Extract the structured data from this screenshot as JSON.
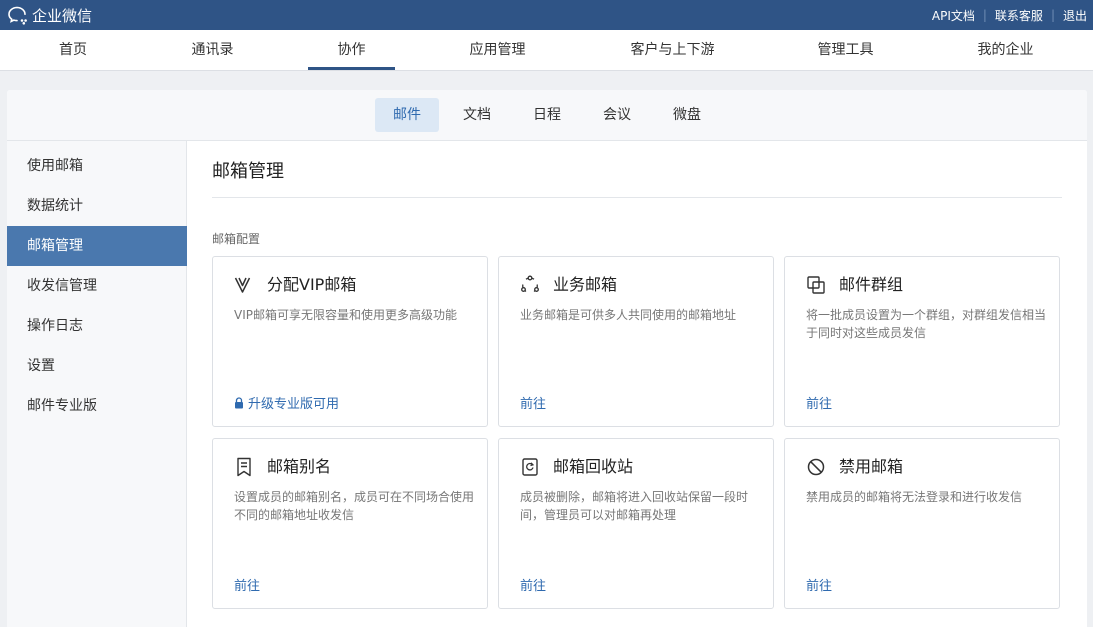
{
  "app": {
    "title": "企业微信"
  },
  "top_links": {
    "api_docs": "API文档",
    "support": "联系客服",
    "logout": "退出"
  },
  "main_nav": [
    "首页",
    "通讯录",
    "协作",
    "应用管理",
    "客户与上下游",
    "管理工具",
    "我的企业"
  ],
  "main_nav_active": "协作",
  "sub_tabs": [
    "邮件",
    "文档",
    "日程",
    "会议",
    "微盘"
  ],
  "sub_tab_active": "邮件",
  "sidebar": [
    "使用邮箱",
    "数据统计",
    "邮箱管理",
    "收发信管理",
    "操作日志",
    "设置",
    "邮件专业版"
  ],
  "sidebar_active": "邮箱管理",
  "page_title": "邮箱管理",
  "section_label": "邮箱配置",
  "cards": [
    {
      "icon": "vip-icon",
      "title": "分配VIP邮箱",
      "desc": "VIP邮箱可享无限容量和使用更多高级功能",
      "link": "升级专业版可用",
      "locked": true
    },
    {
      "icon": "business-mailbox-icon",
      "title": "业务邮箱",
      "desc": "业务邮箱是可供多人共同使用的邮箱地址",
      "link": "前往",
      "locked": false
    },
    {
      "icon": "mail-group-icon",
      "title": "邮件群组",
      "desc": "将一批成员设置为一个群组，对群组发信相当于同时对这些成员发信",
      "link": "前往",
      "locked": false
    },
    {
      "icon": "alias-icon",
      "title": "邮箱别名",
      "desc": "设置成员的邮箱别名，成员可在不同场合使用不同的邮箱地址收发信",
      "link": "前往",
      "locked": false
    },
    {
      "icon": "recycle-bin-icon",
      "title": "邮箱回收站",
      "desc": "成员被删除，邮箱将进入回收站保留一段时间，管理员可以对邮箱再处理",
      "link": "前往",
      "locked": false
    },
    {
      "icon": "ban-icon",
      "title": "禁用邮箱",
      "desc": "禁用成员的邮箱将无法登录和进行收发信",
      "link": "前往",
      "locked": false
    }
  ],
  "colors": {
    "topbar": "#2f5486",
    "accent": "#4a78ae",
    "link": "#2f6aaf",
    "subtab_active_bg": "#dce8f5"
  }
}
